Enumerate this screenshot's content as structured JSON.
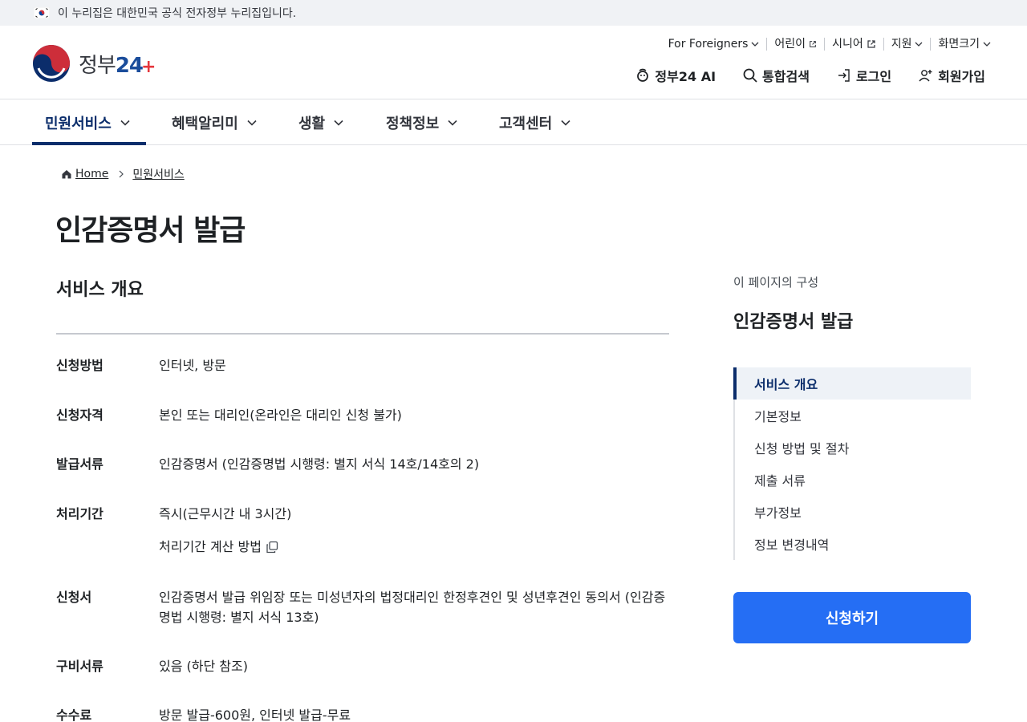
{
  "gov_banner": {
    "text": "이 누리집은 대한민국 공식 전자정부 누리집입니다."
  },
  "logo": {
    "text": "정부",
    "num": "24",
    "plus": "+"
  },
  "util_nav": [
    {
      "label": "For Foreigners",
      "icon": "chevron-down-icon"
    },
    {
      "label": "어린이",
      "icon": "external-link-icon"
    },
    {
      "label": "시니어",
      "icon": "external-link-icon"
    },
    {
      "label": "지원",
      "icon": "chevron-down-icon"
    },
    {
      "label": "화면크기",
      "icon": "chevron-down-icon"
    }
  ],
  "main_actions": [
    {
      "label": "정부24 AI",
      "icon": "ai-icon"
    },
    {
      "label": "통합검색",
      "icon": "search-icon"
    },
    {
      "label": "로그인",
      "icon": "login-icon"
    },
    {
      "label": "회원가입",
      "icon": "user-add-icon"
    }
  ],
  "gnb": [
    {
      "label": "민원서비스",
      "active": true
    },
    {
      "label": "혜택알리미"
    },
    {
      "label": "생활"
    },
    {
      "label": "정책정보"
    },
    {
      "label": "고객센터"
    }
  ],
  "breadcrumb": {
    "home": "Home",
    "current": "민원서비스"
  },
  "page_title": "인감증명서 발급",
  "section": {
    "title": "서비스 개요"
  },
  "info": [
    {
      "label": "신청방법",
      "value": "인터넷, 방문"
    },
    {
      "label": "신청자격",
      "value": "본인 또는 대리인(온라인은 대리인 신청 불가)"
    },
    {
      "label": "발급서류",
      "value": "인감증명서 (인감증명법 시행령: 별지 서식 14호/14호의 2)"
    },
    {
      "label": "처리기간",
      "value": "즉시(근무시간 내 3시간)",
      "link": "처리기간 계산 방법"
    },
    {
      "label": "신청서",
      "value": "인감증명서 발급 위임장 또는 미성년자의 법정대리인 한정후견인 및 성년후견인 동의서 (인감증명법 시행령: 별지 서식 13호)"
    },
    {
      "label": "구비서류",
      "value": "있음 (하단 참조)"
    },
    {
      "label": "수수료",
      "value": "방문 발급-600원, 인터넷 발급-무료"
    }
  ],
  "side": {
    "caption": "이 페이지의 구성",
    "title": "인감증명서 발급",
    "items": [
      {
        "label": "서비스 개요",
        "active": true
      },
      {
        "label": "기본정보"
      },
      {
        "label": "신청 방법 및 절차"
      },
      {
        "label": "제출 서류"
      },
      {
        "label": "부가정보"
      },
      {
        "label": "정보 변경내역"
      }
    ]
  },
  "apply_button": "신청하기",
  "colors": {
    "primary": "#256ef4",
    "navy": "#0b2d6b",
    "banner_bg": "#f0f2f5"
  }
}
